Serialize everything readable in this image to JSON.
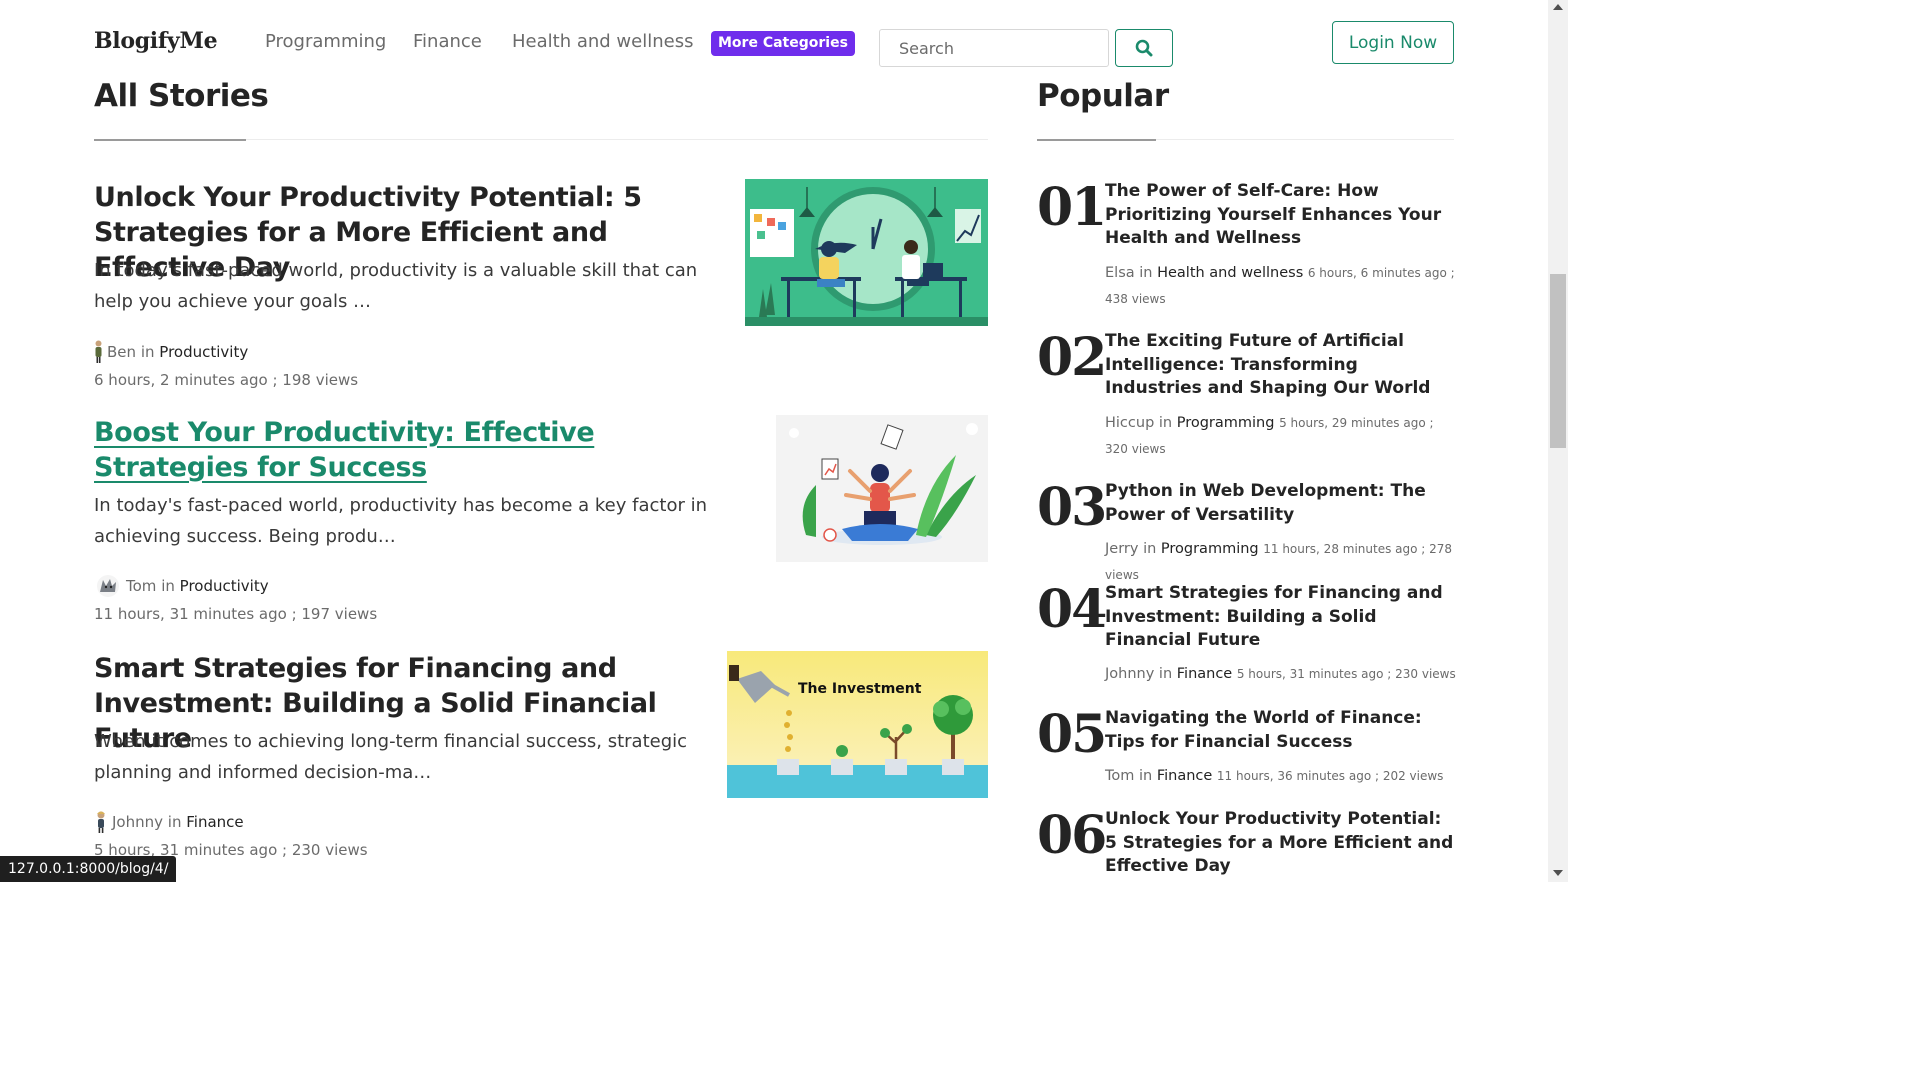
{
  "header": {
    "logo": "BlogifyMe",
    "nav": [
      "Programming",
      "Finance",
      "Health and wellness"
    ],
    "more_categories": "More Categories",
    "search_placeholder": "Search",
    "login": "Login Now"
  },
  "all_stories": {
    "title": "All Stories",
    "stories": [
      {
        "title": "Unlock Your Productivity Potential: 5 Strategies for a More Efficient and Effective Day",
        "excerpt": "In today's fast-paced world, productivity is a valuable skill that can help you achieve your goals …",
        "author": "Ben",
        "in": "in",
        "category": "Productivity",
        "date_views": "6 hours, 2 minutes ago ; 198 views"
      },
      {
        "title": "Boost Your Productivity: Effective Strategies for Success",
        "excerpt": "In today's fast-paced world, productivity has become a key factor in achieving success. Being produ…",
        "author": "Tom",
        "in": "in",
        "category": "Productivity",
        "date_views": "11 hours, 31 minutes ago ; 197 views"
      },
      {
        "title": "Smart Strategies for Financing and Investment: Building a Solid Financial Future",
        "excerpt": "When it comes to achieving long-term financial success, strategic planning and informed decision-ma…",
        "author": "Johnny",
        "in": "in",
        "category": "Finance",
        "date_views": "5 hours, 31 minutes ago ; 230 views",
        "image_caption": "The Investment"
      }
    ]
  },
  "popular": {
    "title": "Popular",
    "items": [
      {
        "num": "01",
        "title": "The Power of Self-Care: How Prioritizing Yourself Enhances Your Health and Wellness",
        "author": "Elsa",
        "in": "in",
        "category": "Health and wellness",
        "stats": "6 hours, 6 minutes ago ; 438 views"
      },
      {
        "num": "02",
        "title": "The Exciting Future of Artificial Intelligence: Transforming Industries and Shaping Our World",
        "author": "Hiccup",
        "in": "in",
        "category": "Programming",
        "stats": "5 hours, 29 minutes ago ; 320 views"
      },
      {
        "num": "03",
        "title": "Python in Web Development: The Power of Versatility",
        "author": "Jerry",
        "in": "in",
        "category": "Programming",
        "stats": "11 hours, 28 minutes ago ; 278 views"
      },
      {
        "num": "04",
        "title": "Smart Strategies for Financing and Investment: Building a Solid Financial Future",
        "author": "Johnny",
        "in": "in",
        "category": "Finance",
        "stats": "5 hours, 31 minutes ago ; 230 views"
      },
      {
        "num": "05",
        "title": "Navigating the World of Finance: Tips for Financial Success",
        "author": "Tom",
        "in": "in",
        "category": "Finance",
        "stats": "11 hours, 36 minutes ago ; 202 views"
      },
      {
        "num": "06",
        "title": "Unlock Your Productivity Potential: 5 Strategies for a More Efficient and Effective Day",
        "author": "",
        "in": "",
        "category": "",
        "stats": ""
      }
    ]
  },
  "status_url": "127.0.0.1:8000/blog/4/",
  "colors": {
    "accent_green": "#1a8a6b",
    "more_categories_purple": "#6f2dec",
    "text_dark": "#242424",
    "text_muted": "#6b6b6b"
  }
}
